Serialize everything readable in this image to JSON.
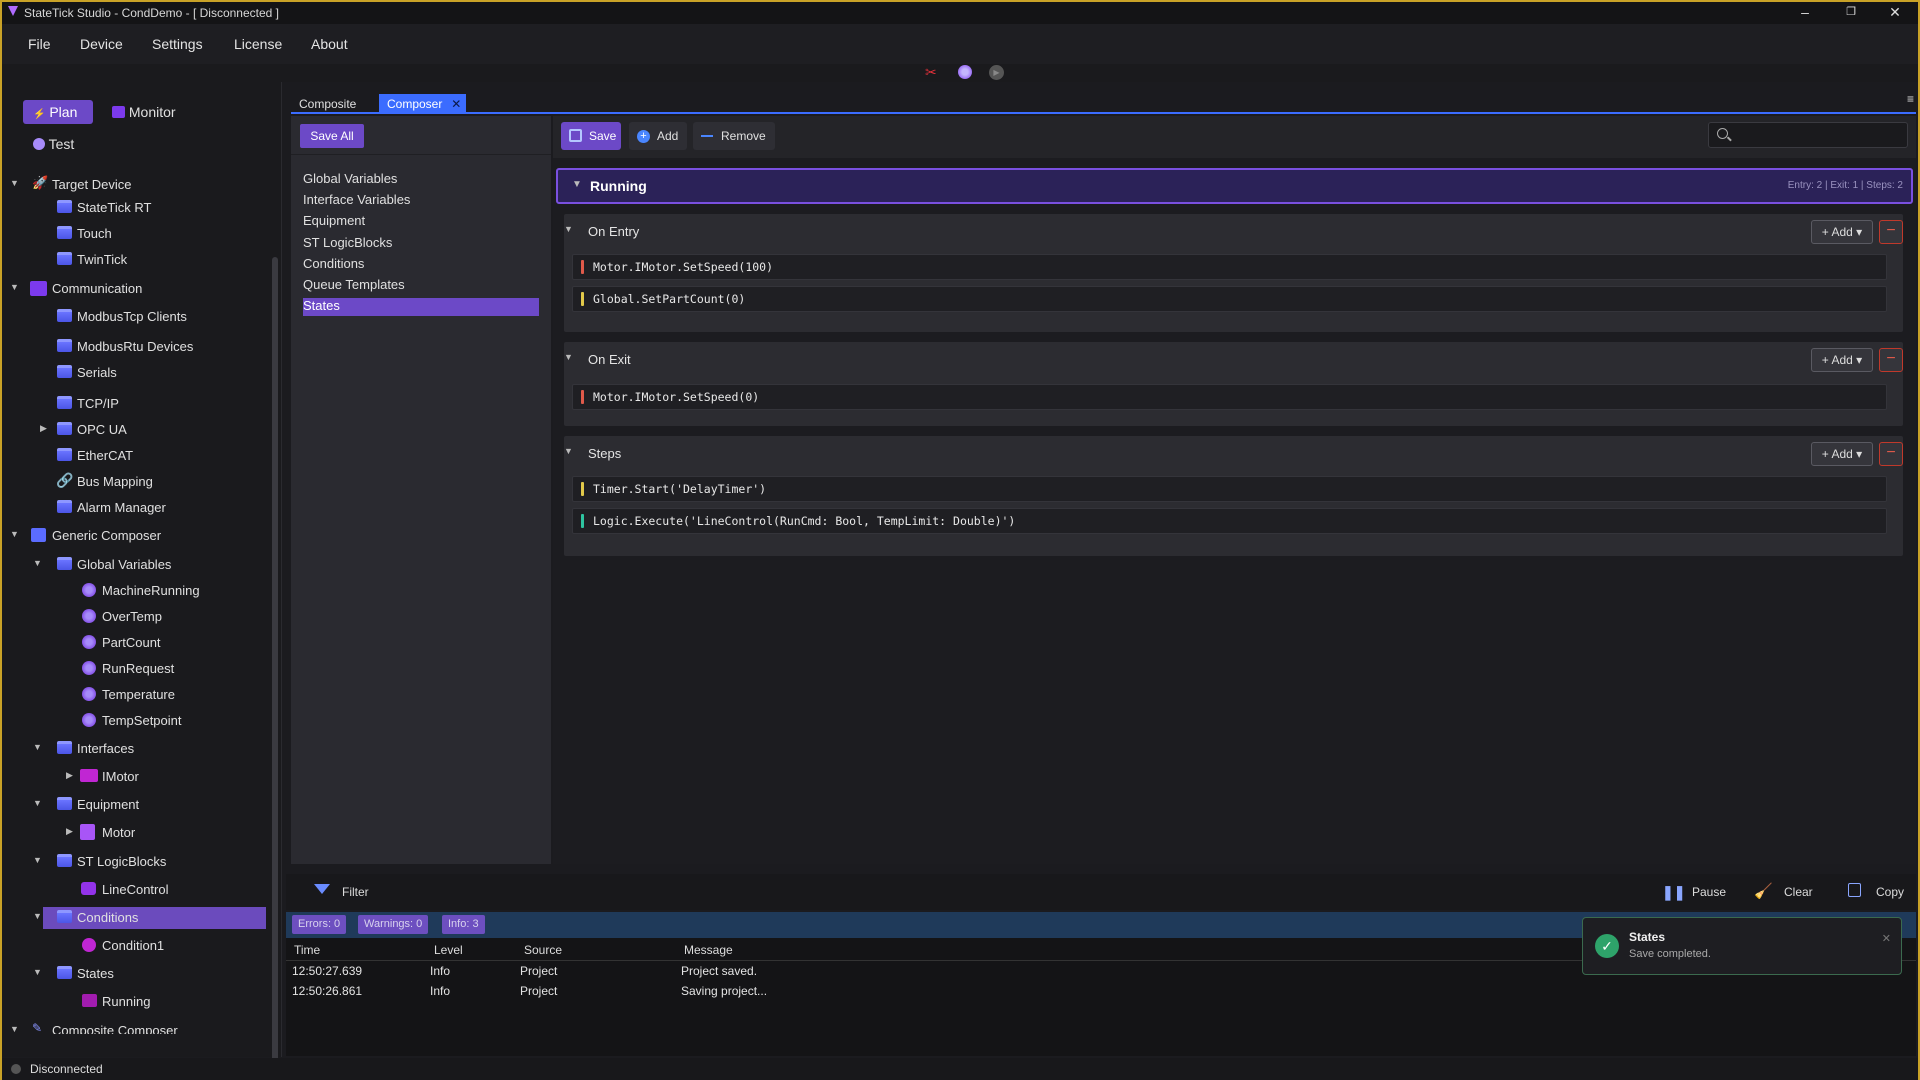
{
  "window": {
    "title": "StateTick Studio  -  CondDemo  -  [ Disconnected ]"
  },
  "menu": [
    "File",
    "Device",
    "Settings",
    "License",
    "About"
  ],
  "modes": {
    "plan": "Plan",
    "monitor": "Monitor",
    "test": "Test"
  },
  "tree": {
    "target_device": "Target Device",
    "statetick_rt": "StateTick RT",
    "touch": "Touch",
    "twintick": "TwinTick",
    "communication": "Communication",
    "modbustcp": "ModbusTcp Clients",
    "modbusrtu": "ModbusRtu Devices",
    "serials": "Serials",
    "tcpip": "TCP/IP",
    "opcua": "OPC UA",
    "ethercat": "EtherCAT",
    "bus_mapping": "Bus Mapping",
    "alarm_manager": "Alarm Manager",
    "generic_composer": "Generic Composer",
    "global_variables": "Global Variables",
    "machine_running": "MachineRunning",
    "overtemp": "OverTemp",
    "partcount": "PartCount",
    "runrequest": "RunRequest",
    "temperature": "Temperature",
    "tempsetpoint": "TempSetpoint",
    "interfaces": "Interfaces",
    "imotor": "IMotor",
    "equipment": "Equipment",
    "motor": "Motor",
    "st_logicblocks": "ST LogicBlocks",
    "linecontrol": "LineControl",
    "conditions": "Conditions",
    "condition1": "Condition1",
    "states": "States",
    "running": "Running",
    "composite_composer": "Composite Composer"
  },
  "tabs": {
    "composite": "Composite",
    "composer": "Composer",
    "close": "✕"
  },
  "left_pane": {
    "save_all": "Save All",
    "items": [
      "Global Variables",
      "Interface Variables",
      "Equipment",
      "ST LogicBlocks",
      "Conditions",
      "Queue Templates",
      "States"
    ]
  },
  "toolbar": {
    "save": "Save",
    "add": "Add",
    "remove": "Remove",
    "search_placeholder": ""
  },
  "state": {
    "name": "Running",
    "summary": "Entry: 2 | Exit: 1 | Steps: 2"
  },
  "sections": {
    "on_entry": "On Entry",
    "on_exit": "On Exit",
    "steps": "Steps",
    "add_label": "+ Add",
    "remove_label": "−",
    "entry_lines": [
      "Motor.IMotor.SetSpeed(100)",
      "Global.SetPartCount(0)"
    ],
    "exit_lines": [
      "Motor.IMotor.SetSpeed(0)"
    ],
    "step_lines": [
      "Timer.Start('DelayTimer')",
      "Logic.Execute('LineControl(RunCmd: Bool, TempLimit: Double)')"
    ]
  },
  "log": {
    "filter": "Filter",
    "pause": "Pause",
    "clear": "Clear",
    "copy": "Copy",
    "errors": "Errors: 0",
    "warnings": "Warnings: 0",
    "info": "Info: 3",
    "headers": [
      "Time",
      "Level",
      "Source",
      "Message"
    ],
    "rows": [
      [
        "12:50:27.639",
        "Info",
        "Project",
        "Project saved."
      ],
      [
        "12:50:26.861",
        "Info",
        "Project",
        "Saving project..."
      ]
    ]
  },
  "toast": {
    "title": "States",
    "message": "Save completed.",
    "close": "✕"
  },
  "status": {
    "text": "Disconnected"
  },
  "colors": {
    "accent": "#6c49c7",
    "tab_active": "#3b6cff",
    "success": "#2ea36a",
    "error": "#c0392b"
  }
}
